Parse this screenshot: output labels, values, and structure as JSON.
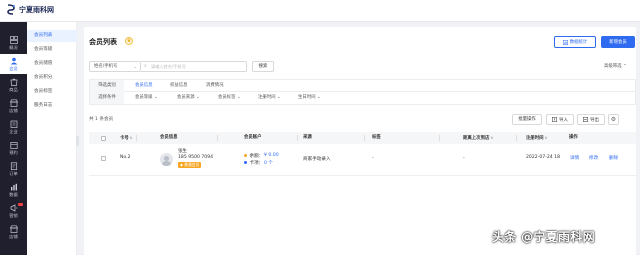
{
  "app": {
    "logo_text": "宁夏雨科网"
  },
  "sidebar": {
    "items": [
      {
        "label": "概况",
        "icon": "dashboard-icon"
      },
      {
        "label": "会员",
        "icon": "member-icon",
        "active": true
      },
      {
        "label": "商品",
        "icon": "goods-icon"
      },
      {
        "label": "店铺",
        "icon": "store-icon"
      },
      {
        "label": "企业",
        "icon": "company-icon"
      },
      {
        "label": "预约",
        "icon": "appointment-icon"
      },
      {
        "label": "订单",
        "icon": "order-icon"
      },
      {
        "label": "数据",
        "icon": "data-icon"
      },
      {
        "label": "营销",
        "icon": "marketing-icon"
      },
      {
        "label": "店铺",
        "icon": "shop-icon"
      }
    ]
  },
  "subnav": {
    "items": [
      {
        "label": "会员列表",
        "active": true
      },
      {
        "label": "会员等级"
      },
      {
        "label": "会员储值"
      },
      {
        "label": "会员积分"
      },
      {
        "label": "会员标签"
      },
      {
        "label": "服务日志"
      }
    ]
  },
  "header": {
    "title": "会员列表",
    "stats_button": "数据统计",
    "add_button": "新增会员"
  },
  "search": {
    "type_select": "姓名/手机号",
    "placeholder": "请输入姓名/手机号",
    "search_button": "搜索",
    "advanced_filter": "高级筛选"
  },
  "filters": {
    "row1_label": "筛选类别",
    "row1_options": [
      {
        "label": "会员信息",
        "active": true
      },
      {
        "label": "权益信息"
      },
      {
        "label": "消费情况"
      }
    ],
    "row2_label": "选择条件",
    "row2_options": [
      {
        "label": "会员等级"
      },
      {
        "label": "会员来源"
      },
      {
        "label": "会员标签"
      },
      {
        "label": "注册时间"
      },
      {
        "label": "生日时间"
      }
    ]
  },
  "toolbar": {
    "total_text": "共 1 条会员",
    "batch_button": "批量操作",
    "import_button": "导入",
    "export_button": "导出"
  },
  "table": {
    "headers": {
      "card_no": "卡号",
      "member_info": "会员信息",
      "member_account": "会员账户",
      "source": "来源",
      "tags": "标签",
      "since_last_visit": "距离上次到店",
      "register_time": "注册时间",
      "actions": "操作"
    },
    "rows": [
      {
        "card_no": "No.2",
        "name": "张生",
        "phone": "185 9500 7094",
        "level": "普通会员",
        "balance_label": "余额：",
        "balance_value": "¥ 0.00",
        "card_label": "卡项：",
        "card_value": "0 个",
        "source": "商家手动录入",
        "tags": "-",
        "since_last_visit": "-",
        "register_time": "2022-07-24 18",
        "actions": [
          "详情",
          "修改",
          "删除"
        ]
      }
    ]
  },
  "watermark": "头条 @宁夏雨科网",
  "colors": {
    "accent": "#2f6bf0",
    "sidebar_bg": "#1f1f2e",
    "level_tag": "#f6a623"
  }
}
